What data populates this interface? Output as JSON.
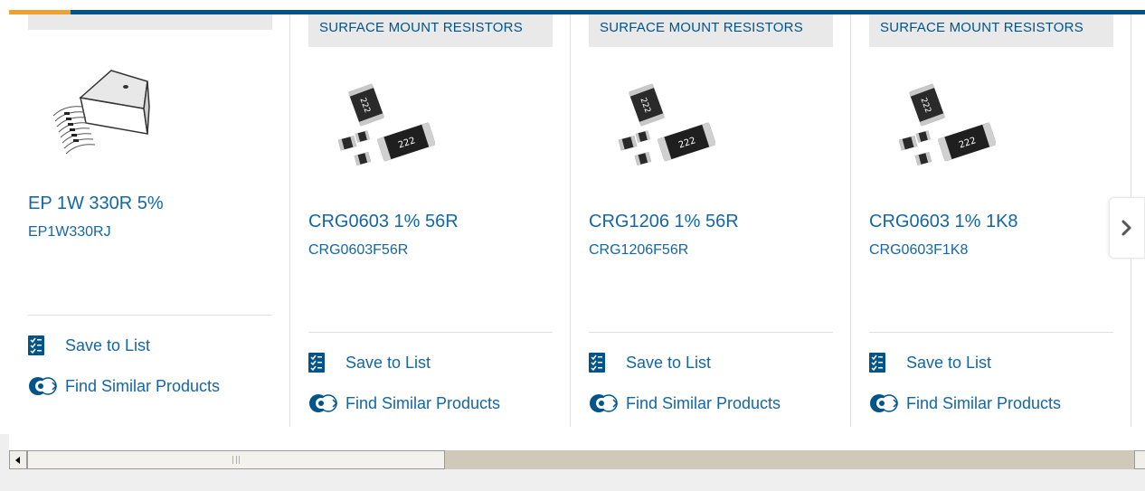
{
  "carousel": {
    "cards": [
      {
        "category": "",
        "name": "EP 1W 330R 5%",
        "code": "EP1W330RJ",
        "image": "ammo-pack-resistor-image",
        "save_label": "Save to List",
        "similar_label": "Find Similar Products"
      },
      {
        "category": "SURFACE MOUNT RESISTORS",
        "name": "CRG0603 1% 56R",
        "code": "CRG0603F56R",
        "image": "smd-resistor-image",
        "save_label": "Save to List",
        "similar_label": "Find Similar Products"
      },
      {
        "category": "SURFACE MOUNT RESISTORS",
        "name": "CRG1206 1% 56R",
        "code": "CRG1206F56R",
        "image": "smd-resistor-image",
        "save_label": "Save to List",
        "similar_label": "Find Similar Products"
      },
      {
        "category": "SURFACE MOUNT RESISTORS",
        "name": "CRG0603 1% 1K8",
        "code": "CRG0603F1K8",
        "image": "smd-resistor-image",
        "save_label": "Save to List",
        "similar_label": "Find Similar Products"
      }
    ],
    "resistor_marking": "222",
    "next_icon": "chevron-right-icon"
  },
  "colors": {
    "brand_blue": "#00548a",
    "link_blue": "#1366a8",
    "accent_orange": "#f0a030",
    "tab_gray": "#e9e9e9"
  },
  "scrollbar": {
    "position_fraction": 0.0
  }
}
